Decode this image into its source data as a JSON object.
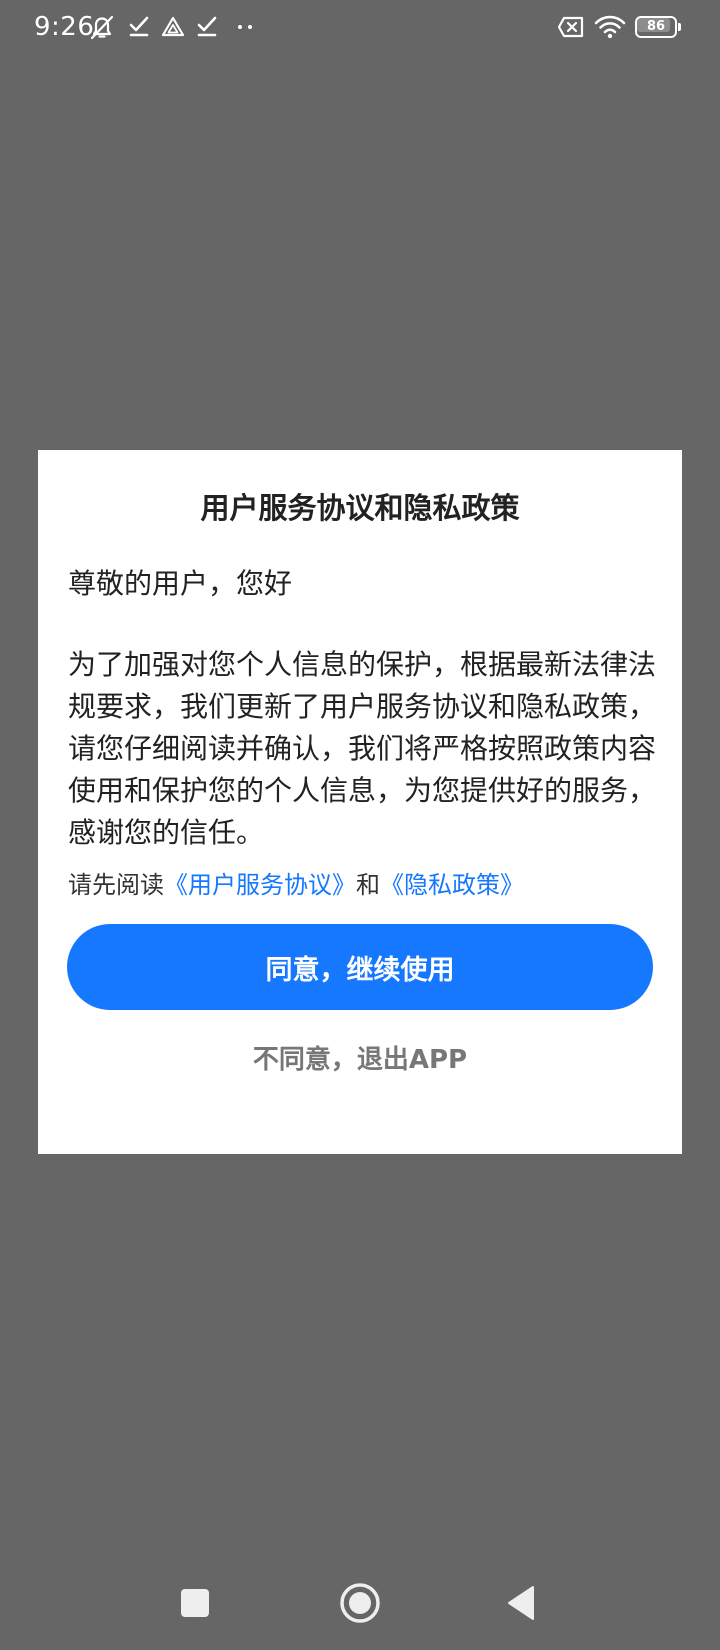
{
  "status_bar": {
    "time": "9:26",
    "battery_level": 86,
    "battery_text": "86",
    "icons": [
      "alarm-off-icon",
      "check-icon",
      "drive-icon",
      "check-icon",
      "more-dots-icon",
      "no-sim-icon",
      "wifi-icon",
      "battery-icon"
    ]
  },
  "dialog": {
    "title": "用户服务协议和隐私政策",
    "greeting": "尊敬的用户，您好",
    "body": "为了加强对您个人信息的保护，根据最新法律法规要求，我们更新了用户服务协议和隐私政策，请您仔细阅读并确认，我们将严格按照政策内容使用和保护您的个人信息，为您提供好的服务，感谢您的信任。",
    "links_prefix": "请先阅读",
    "link_user_agreement": "《用户服务协议》",
    "links_conjunction": "和",
    "link_privacy_policy": "《隐私政策》",
    "agree_label": "同意，继续使用",
    "disagree_label": "不同意，退出APP"
  },
  "navigation": {
    "icons": [
      "recents-square-icon",
      "home-circle-icon",
      "back-triangle-icon"
    ]
  },
  "colors": {
    "overlay": "#666666",
    "accent": "#1677ff",
    "dialog_bg": "#ffffff"
  }
}
